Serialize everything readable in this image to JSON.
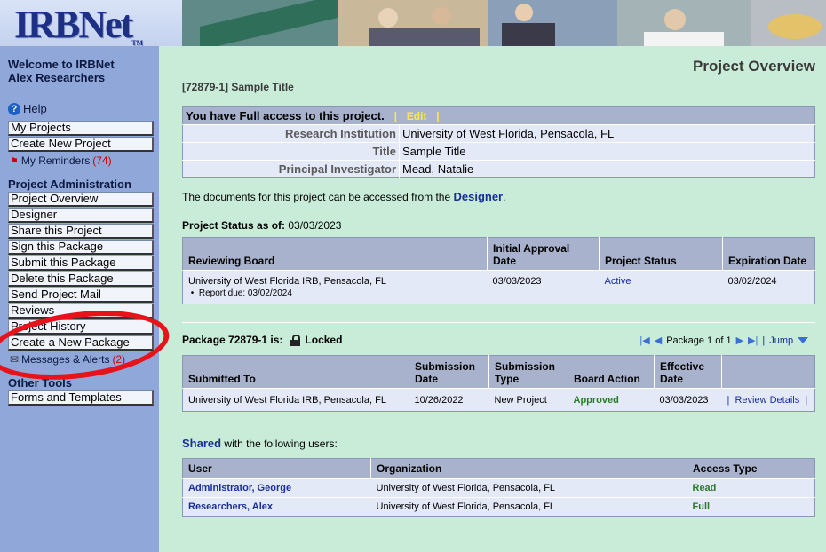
{
  "header": {
    "logo_text": "IRBNet",
    "logo_tm": "TM"
  },
  "sidebar": {
    "welcome_line1": "Welcome to IRBNet",
    "welcome_line2": "Alex Researchers",
    "help": "Help",
    "my_projects": "My Projects",
    "create_new_project": "Create New Project",
    "my_reminders": "My Reminders",
    "my_reminders_count": "(74)",
    "section_project_admin": "Project Administration",
    "project_overview": "Project Overview",
    "designer": "Designer",
    "share_project": "Share this Project",
    "sign_package": "Sign this Package",
    "submit_package": "Submit this Package",
    "delete_package": "Delete this Package",
    "send_mail": "Send Project Mail",
    "reviews": "Reviews",
    "project_history": "Project History",
    "create_package": "Create a New Package",
    "messages_alerts": "Messages & Alerts",
    "messages_count": "(2)",
    "section_other_tools": "Other Tools",
    "forms_templates": "Forms and Templates"
  },
  "main": {
    "page_title": "Project Overview",
    "breadcrumb": "[72879-1] Sample Title",
    "access": {
      "header": "You have Full access to this project.",
      "edit": "Edit",
      "rows": [
        {
          "label": "Research Institution",
          "value": "University of West Florida, Pensacola, FL"
        },
        {
          "label": "Title",
          "value": "Sample Title"
        },
        {
          "label": "Principal Investigator",
          "value": "Mead, Natalie"
        }
      ]
    },
    "doc_line_pre": "The documents for this project can be accessed from the ",
    "doc_line_link": "Designer",
    "doc_line_post": ".",
    "status_label": "Project Status as of:",
    "status_date": "03/03/2023",
    "review_table": {
      "headers": [
        "Reviewing Board",
        "Initial Approval Date",
        "Project Status",
        "Expiration Date"
      ],
      "board": "University of West Florida IRB, Pensacola, FL",
      "report_due": "Report due: 03/02/2024",
      "initial_approval": "03/03/2023",
      "status": "Active",
      "expiration": "03/02/2024"
    },
    "package": {
      "label": "Package 72879-1 is:",
      "state": "Locked",
      "pager": "Package 1 of 1",
      "jump": "Jump",
      "sep": "|"
    },
    "package_table": {
      "headers": [
        "Submitted To",
        "Submission Date",
        "Submission Type",
        "Board Action",
        "Effective Date"
      ],
      "submitted_to": "University of West Florida IRB, Pensacola, FL",
      "submission_date": "10/26/2022",
      "submission_type": "New Project",
      "board_action": "Approved",
      "effective_date": "03/03/2023",
      "review_details": "Review Details"
    },
    "shared_link": "Shared",
    "shared_post": " with the following users:",
    "shared_table": {
      "headers": [
        "User",
        "Organization",
        "Access Type"
      ],
      "rows": [
        {
          "user": "Administrator, George",
          "org": "University of West Florida, Pensacola, FL",
          "access": "Read"
        },
        {
          "user": "Researchers, Alex",
          "org": "University of West Florida, Pensacola, FL",
          "access": "Full"
        }
      ]
    }
  },
  "colors": {
    "header_bg": "#2c3f7a",
    "sidebar_bg": "#8fa8d9",
    "content_bg": "#c8ecd8",
    "table_header": "#a8b2cc",
    "table_cell": "#e4e9f7",
    "link": "#1a2f9a",
    "annotation": "#e8121b"
  }
}
